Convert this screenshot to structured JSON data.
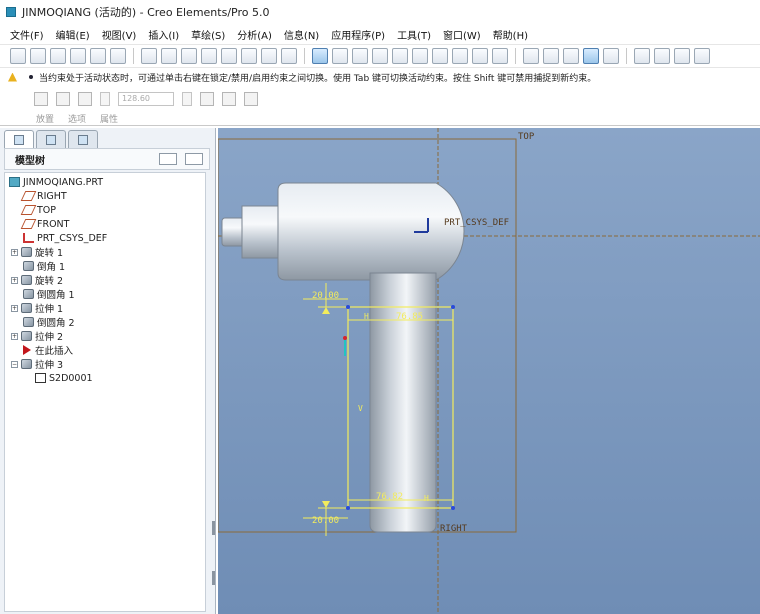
{
  "window": {
    "title": "JINMOQIANG (活动的) - Creo Elements/Pro 5.0"
  },
  "menu": [
    "文件(F)",
    "编辑(E)",
    "视图(V)",
    "插入(I)",
    "草绘(S)",
    "分析(A)",
    "信息(N)",
    "应用程序(P)",
    "工具(T)",
    "窗口(W)",
    "帮助(H)"
  ],
  "status": {
    "message": "当约束处于活动状态时，可通过单击右键在锁定/禁用/启用约束之间切换。使用 Tab 键可切换活动约束。按住 Shift 键可禁用捕捉到新约束。"
  },
  "dashboard": {
    "value_placeholder": "128.60",
    "tabs": [
      "放置",
      "选项",
      "属性"
    ]
  },
  "tree": {
    "header": "模型树",
    "items": [
      {
        "label": "JINMOQIANG.PRT",
        "icon": "part-icon"
      },
      {
        "label": "RIGHT",
        "icon": "datum-plane-icon"
      },
      {
        "label": "TOP",
        "icon": "datum-plane-icon"
      },
      {
        "label": "FRONT",
        "icon": "datum-plane-icon"
      },
      {
        "label": "PRT_CSYS_DEF",
        "icon": "csys-icon"
      },
      {
        "label": "旋转 1",
        "icon": "revolve-icon"
      },
      {
        "label": "倒角 1",
        "icon": "chamfer-icon"
      },
      {
        "label": "旋转 2",
        "icon": "revolve-icon"
      },
      {
        "label": "倒圆角 1",
        "icon": "round-icon"
      },
      {
        "label": "拉伸 1",
        "icon": "extrude-icon"
      },
      {
        "label": "倒圆角 2",
        "icon": "round-icon"
      },
      {
        "label": "拉伸 2",
        "icon": "extrude-icon"
      },
      {
        "label": "在此插入",
        "icon": "insert-here-icon"
      },
      {
        "label": "拉伸 3",
        "icon": "extrude-icon"
      },
      {
        "label": "S2D0001",
        "icon": "sketch-icon"
      }
    ]
  },
  "graphics": {
    "datum_top": "TOP",
    "datum_right": "RIGHT",
    "csys": "PRT_CSYS_DEF",
    "dim_top": "20.00",
    "dim_bottom": "20.00",
    "dim_width_top": "76.85",
    "dim_width_bottom": "76.82",
    "label_h_top": "H",
    "label_h_bottom": "H",
    "label_v": "V"
  },
  "colors": {
    "background_top": "#8aa5c8",
    "background_bottom": "#6f8db5",
    "sketch": "#f3ec5c",
    "datum": "#8a6a3a",
    "dimension_point": "#2a4bd8"
  }
}
